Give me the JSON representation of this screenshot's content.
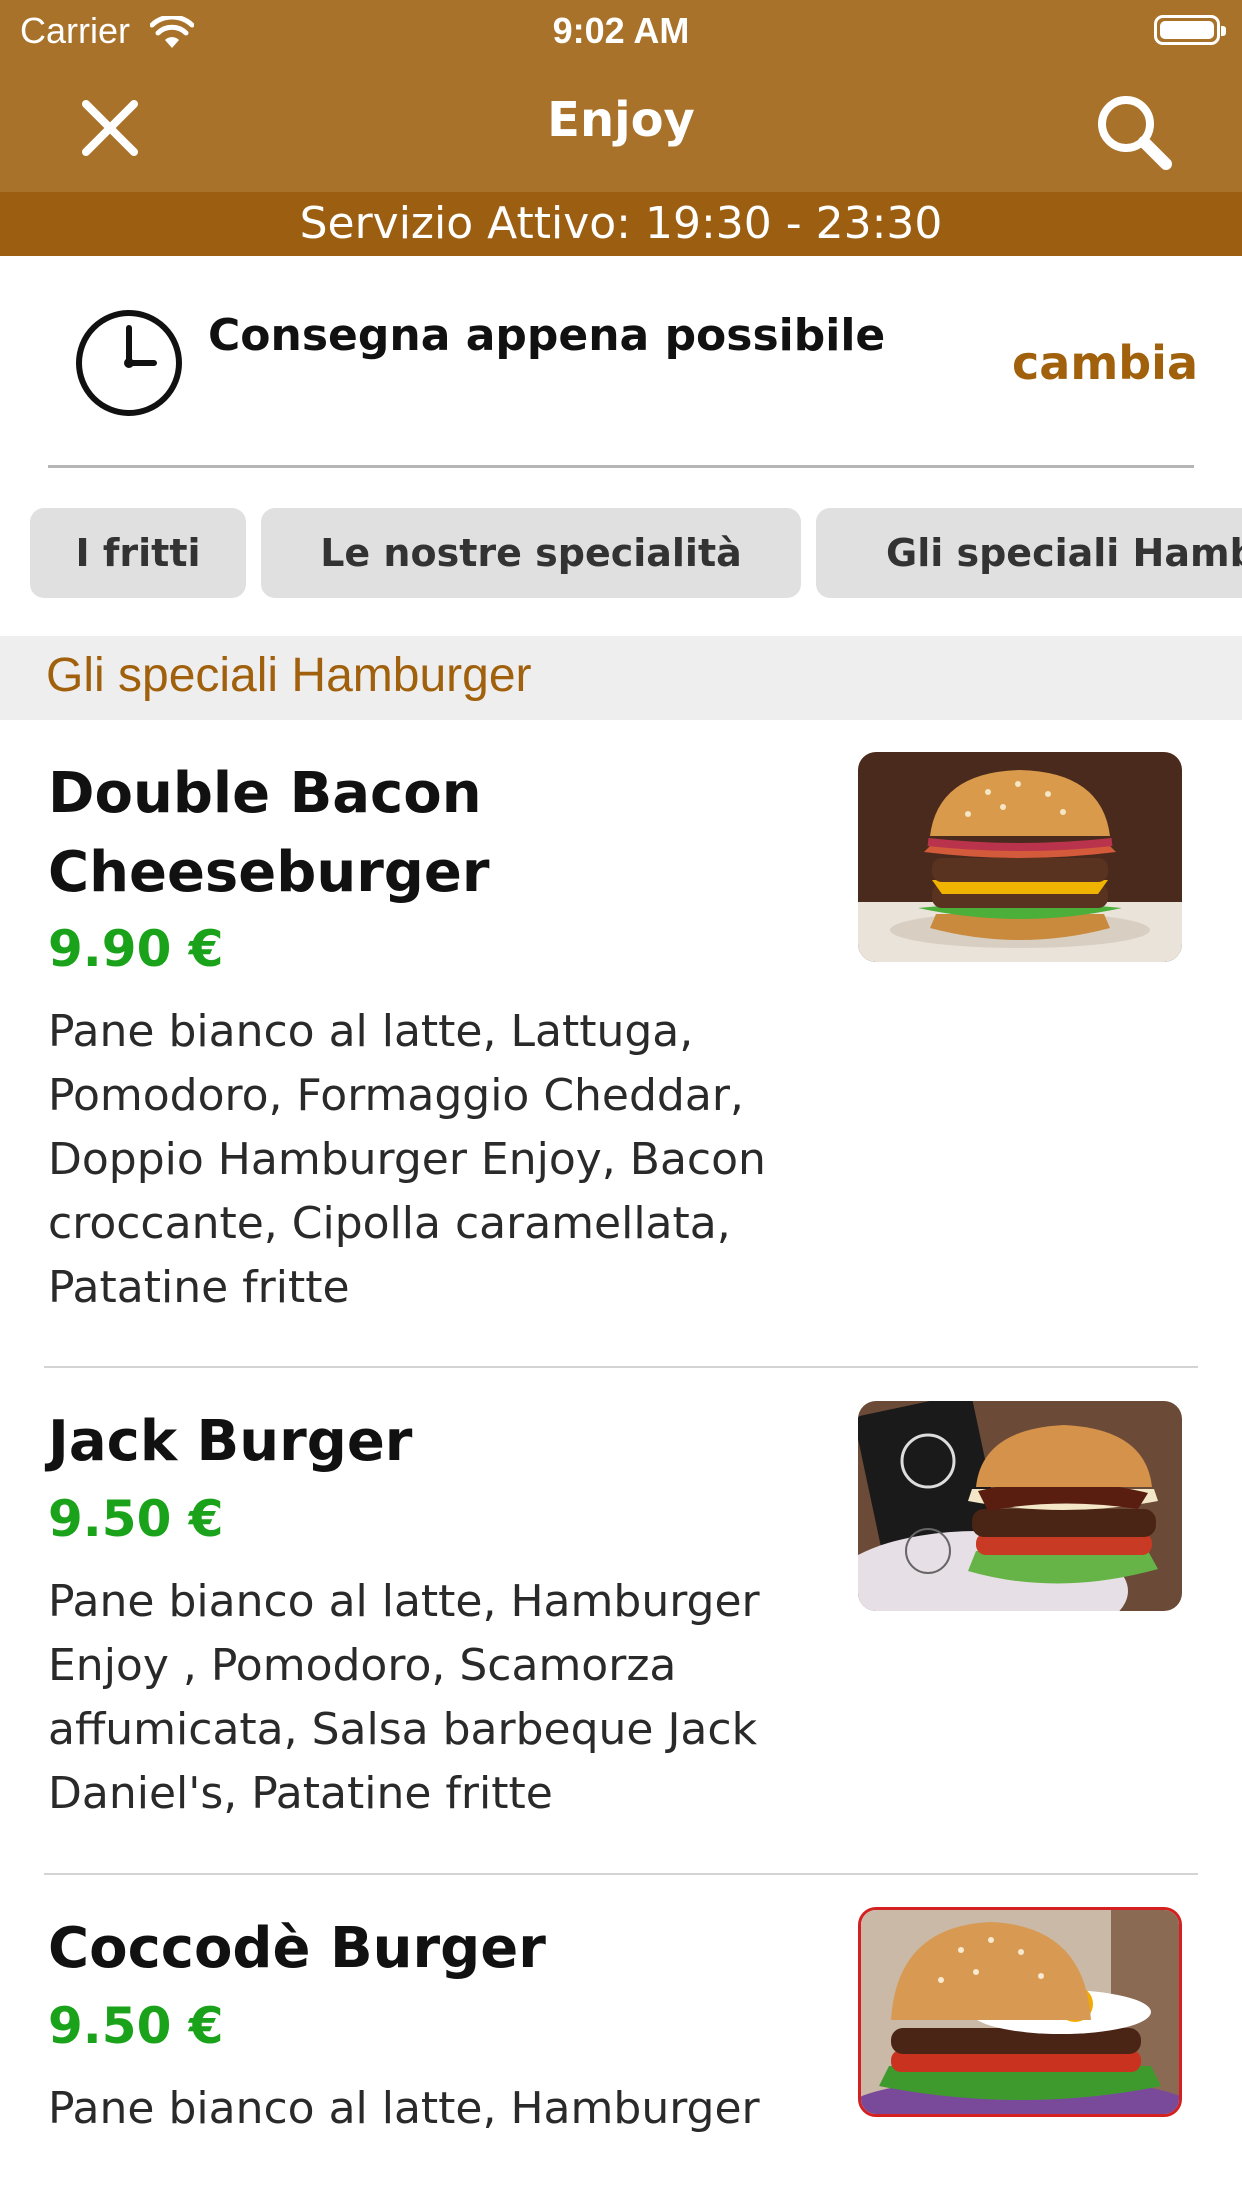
{
  "status_bar": {
    "carrier": "Carrier",
    "time": "9:02 AM"
  },
  "nav": {
    "title": "Enjoy",
    "close_icon": "close-icon",
    "search_icon": "search-icon"
  },
  "service": {
    "text": "Servizio Attivo: 19:30 - 23:30"
  },
  "delivery": {
    "label": "Consegna appena possibile",
    "change_label": "cambia",
    "icon": "clock-icon"
  },
  "categories": [
    {
      "label": "I fritti"
    },
    {
      "label": "Le nostre specialità"
    },
    {
      "label": "Gli speciali Hamburger"
    }
  ],
  "section": {
    "title": "Gli speciali Hamburger"
  },
  "items": [
    {
      "name": "Double Bacon Cheeseburger",
      "price": "9.90 €",
      "description": "Pane bianco al latte, Lattuga, Pomodoro, Formaggio Cheddar, Doppio Hamburger Enjoy, Bacon croccante, Cipolla caramellata, Patatine fritte"
    },
    {
      "name": "Jack Burger",
      "price": "9.50 €",
      "description": "Pane bianco al latte, Hamburger Enjoy , Pomodoro, Scamorza affumicata, Salsa barbeque Jack Daniel's, Patatine fritte"
    },
    {
      "name": "Coccodè Burger",
      "price": "9.50 €",
      "description": "Pane bianco al latte, Hamburger"
    }
  ],
  "colors": {
    "nav_bg": "#a8722a",
    "service_bg": "#9c5e10",
    "accent": "#a0600c",
    "price": "#1aa31a"
  }
}
